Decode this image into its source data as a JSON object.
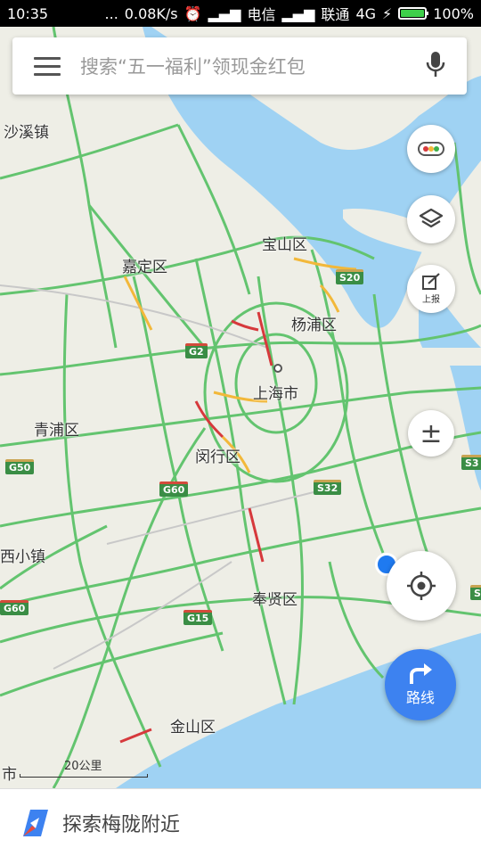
{
  "status_bar": {
    "time": "10:35",
    "dots": "...",
    "speed": "0.08K/s",
    "carrier1": "电信",
    "carrier2": "联通",
    "network": "4G",
    "battery_pct": "100%",
    "battery_level": 1.0
  },
  "search": {
    "placeholder": "搜索“五一福利”领现金红包"
  },
  "map": {
    "places": {
      "shaxizhen": "沙溪镇",
      "baoshan": "宝山区",
      "jiading": "嘉定区",
      "yangpu": "杨浦区",
      "shanghai": "上海市",
      "qingpu": "青浦区",
      "minhang": "闵行区",
      "xixiaozhen": "西小镇",
      "fengxian": "奉贤区",
      "jinshan": "金山区",
      "shi": "市"
    },
    "roads": {
      "s20": "S20",
      "g2": "G2",
      "g50": "G50",
      "g60a": "G60",
      "s32": "S32",
      "g15": "G15",
      "g60b": "G60",
      "s3": "S3",
      "s3b": "S"
    },
    "scale_label": "20公里",
    "colors": {
      "water": "#9fd2f3",
      "land": "#eeeee6",
      "highway": "#63c46f",
      "traffic_slow": "#f2b83a",
      "traffic_jam": "#d6393c",
      "accent": "#3d82f0"
    }
  },
  "controls": {
    "traffic_icon": "traffic-light-icon",
    "layers_icon": "layers-icon",
    "report_label": "上报",
    "zoom_label": "±",
    "route_label": "路线"
  },
  "bottom": {
    "explore_text": "探索梅陇附近"
  }
}
